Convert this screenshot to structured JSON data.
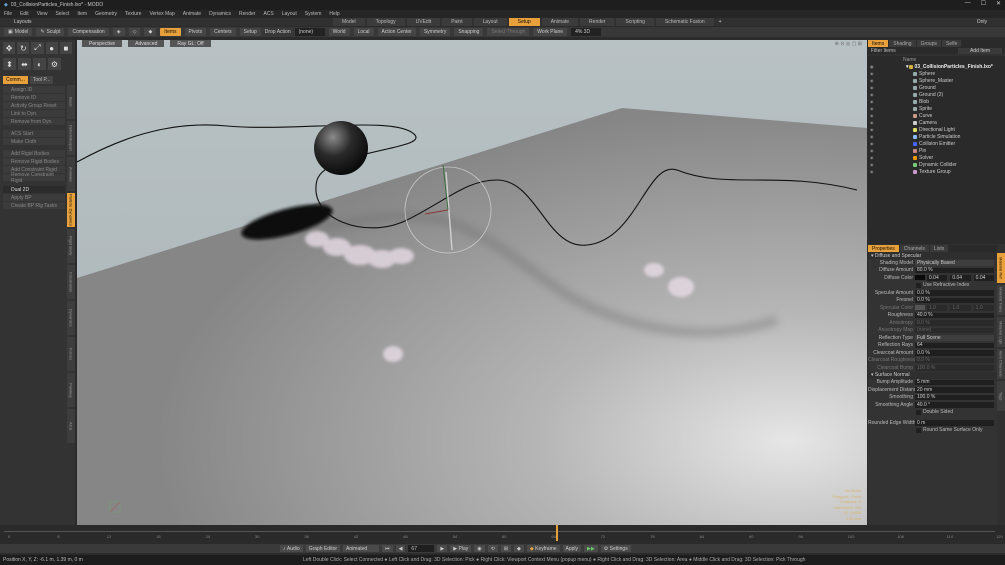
{
  "titlebar": {
    "title": "03_CollisionParticles_Finish.lxo* - MODO",
    "minimize": "—",
    "maximize": "☐",
    "close": "✕"
  },
  "menubar": [
    "File",
    "Edit",
    "View",
    "Select",
    "Item",
    "Geometry",
    "Texture",
    "Vertex Map",
    "Animate",
    "Dynamics",
    "Render",
    "ACS",
    "Layout",
    "System",
    "Help"
  ],
  "layoutbar": {
    "label": "Layouts",
    "tabs": [
      "Model",
      "Topology",
      "UVEdit",
      "Paint",
      "Layout",
      "Setup",
      "Animate",
      "Render",
      "Scripting",
      "Schematic Fusion"
    ],
    "active": "Setup",
    "only": "Only"
  },
  "toolbar": {
    "model": "Model",
    "sculpt": "Sculpt",
    "compensation": "Compensation",
    "items": "Items",
    "pivots": "Pivots",
    "centers": "Centers",
    "setup": "Setup",
    "drop_action": "Drop Action",
    "drop_value": "(none)",
    "world": "World",
    "local": "Local",
    "action_center": "Action Center",
    "symmetry": "Symmetry",
    "snapping": "Snapping",
    "falloff": "Select Through",
    "work_plane": "Work Plane",
    "elapsed": "4% 3D"
  },
  "leftpalette": {
    "tabs": [
      "Comm...",
      "Tool P..."
    ],
    "tools": [
      "Assign ID",
      "Remove ID",
      "Activity Group Reset",
      "Link to Dyn.",
      "Remove from Dyn.",
      "ACS Start",
      "Make Cloth",
      "Add Rigid Bodies",
      "Remove Rigid Bodies",
      "Add Constraint Rigid",
      "Remove Constraint Rigid",
      "Dual 2D",
      "Apply BP",
      "Create BP Rig Tasks"
    ],
    "highlight": "Dual 2D",
    "vtabs": [
      "Basic",
      "Deform/Export",
      "Animate",
      "Particle Dynamics",
      "Rigid Body",
      "Constraints",
      "Dynamics",
      "Forces",
      "Painting",
      "ACS"
    ],
    "active_vtab": "Particle Dynamics"
  },
  "viewport": {
    "perspective": "Perspective",
    "advanced": "Advanced",
    "ray_gl": "Ray GL: Off",
    "stats": [
      "No Items",
      "Polygons : Face",
      "Channels: 0",
      "Deformers: ON",
      "GL: 9,858",
      "100 mm"
    ]
  },
  "rightpanel": {
    "tabs": [
      "Items",
      "Shading",
      "Groups",
      "Selfe"
    ],
    "filter": "Filter Items",
    "add_item": "Add Item",
    "tree_header": "Name",
    "scene": "03_CollisionParticles_Finish.lxo*",
    "items": [
      "Sphere",
      "Sphere_Master",
      "Ground",
      "Ground (2)",
      "Blob",
      "Sprite",
      "Curve",
      "Camera",
      "Directional Light",
      "Particle Simulation",
      "Collision Emitter",
      "Pin",
      "Solver",
      "Dynamic Collider",
      "Texture Group"
    ],
    "prop_tabs": [
      "Properties",
      "Channels",
      "Lists"
    ],
    "sec1": "Diffuse and Specular",
    "shading_model": {
      "label": "Shading Model",
      "value": "Physically Based"
    },
    "diffuse_amount": {
      "label": "Diffuse Amount",
      "value": "80.0 %"
    },
    "diffuse_color": {
      "label": "Diffuse Color",
      "r": "0.04",
      "g": "0.04",
      "b": "0.04"
    },
    "use_refr": "Use Refractive Index",
    "specular_amount": {
      "label": "Specular Amount",
      "value": "0.0 %"
    },
    "fresnel": {
      "label": "Fresnel",
      "value": "0.0 %"
    },
    "specular_color": {
      "label": "Specular Color",
      "r": "1.0",
      "g": "1.0",
      "b": "1.0"
    },
    "roughness": {
      "label": "Roughness",
      "value": "40.0 %"
    },
    "anisotropy": {
      "label": "Anisotropy",
      "value": "0.0 %"
    },
    "aniso_map": {
      "label": "Anisotropy Map",
      "value": "(none)"
    },
    "refl_type": {
      "label": "Reflection Type",
      "value": "Full Scene"
    },
    "refl_rays": {
      "label": "Reflection Rays",
      "value": "64"
    },
    "clearcoat": {
      "label": "Clearcoat Amount",
      "value": "0.0 %"
    },
    "cc_rough": {
      "label": "Clearcoat Roughness",
      "value": "0.0 %"
    },
    "cc_bump": {
      "label": "Clearcoat Bump",
      "value": "100.0 %"
    },
    "sec2": "Surface Normal",
    "bump_amp": {
      "label": "Bump Amplitude",
      "value": "5 mm"
    },
    "disp_dist": {
      "label": "Displacement Distance",
      "value": "20 mm"
    },
    "smoothing": {
      "label": "Smoothing",
      "value": "100.0 %"
    },
    "smooth_angle": {
      "label": "Smoothing Angle",
      "value": "40.0 °"
    },
    "double_sided": "Double Sided",
    "rounded_edge": {
      "label": "Rounded Edge Width",
      "value": "0 m"
    },
    "round_same": "Round Same Surface Only",
    "rvtabs": [
      "Material Ref",
      "Material Trans",
      "Material Ligh",
      "Item Channels",
      "Tags"
    ]
  },
  "timeline": {
    "labels": [
      "0",
      "6",
      "12",
      "18",
      "24",
      "30",
      "36",
      "42",
      "48",
      "54",
      "60",
      "66",
      "72",
      "78",
      "84",
      "90",
      "96",
      "102",
      "108",
      "114",
      "120"
    ],
    "current": "67"
  },
  "bottombar": {
    "audio": "Audio",
    "graph": "Graph Editor",
    "animated": "Animated",
    "frame": "67",
    "play": "Play",
    "keyframe": "Keyframe",
    "apply": "Apply",
    "settings": "Settings"
  },
  "statusbar": {
    "left": "Position X, Y, Z:  -6.1 m, 1.39 m, 0 m",
    "right": "Left Double Click: Select Connected ● Left Click and Drag: 3D Selection: Pick ● Right Click: Viewport Context Menu (popup menu) ● Right Click and Drag: 3D Selection: Area ● Middle Click and Drag: 3D Selection: Pick Through"
  }
}
